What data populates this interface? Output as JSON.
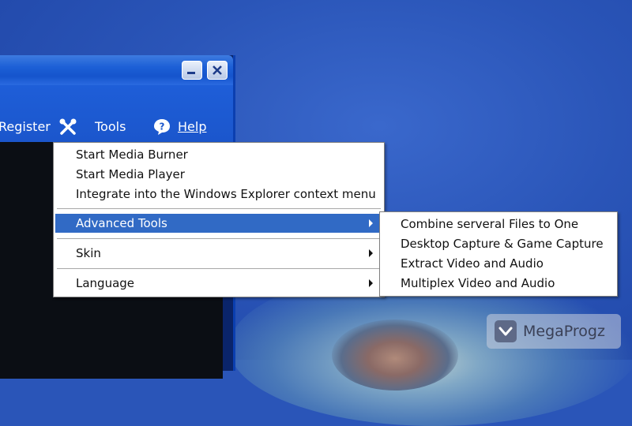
{
  "window": {
    "toolbar": {
      "register_label": "Register",
      "tools_label": "Tools",
      "help_label": "Help"
    },
    "titlebar": {
      "minimize_icon": "minimize-icon",
      "close_icon": "close-icon"
    }
  },
  "tools_menu": {
    "items": [
      {
        "label": "Start Media Burner"
      },
      {
        "label": "Start Media Player"
      },
      {
        "label": "Integrate into the Windows Explorer context menu"
      },
      {
        "label": "Advanced Tools",
        "submenu": true,
        "selected": true
      },
      {
        "label": "Skin",
        "submenu": true
      },
      {
        "label": "Language",
        "submenu": true
      }
    ]
  },
  "advanced_tools_submenu": {
    "items": [
      {
        "label": "Combine serveral Files to One"
      },
      {
        "label": "Desktop Capture & Game Capture"
      },
      {
        "label": "Extract Video and Audio"
      },
      {
        "label": "Multiplex Video and Audio"
      }
    ]
  },
  "watermark": {
    "text": "MegaProgz"
  },
  "colors": {
    "selection": "#316ac5",
    "desktop": "#2a55b8",
    "titlebar": "#1c5fd6"
  }
}
